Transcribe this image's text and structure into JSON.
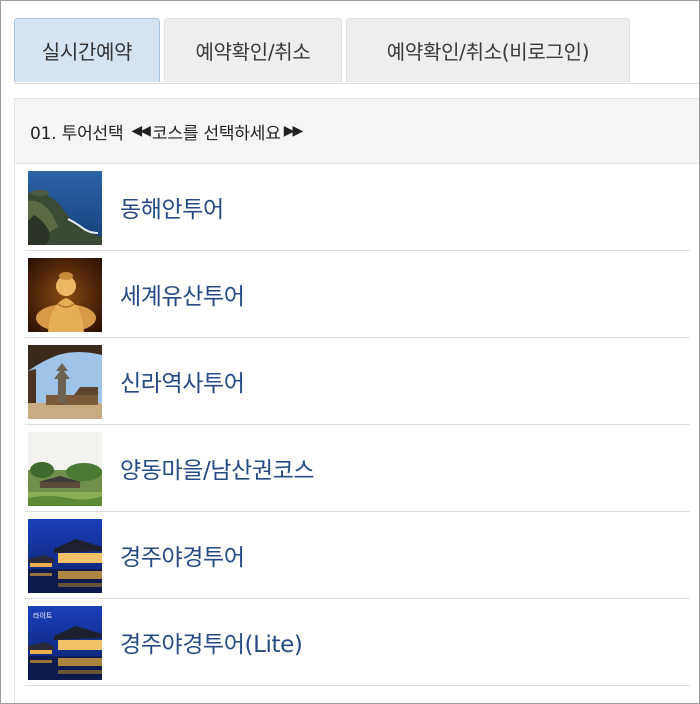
{
  "tabs": [
    {
      "label": "실시간예약",
      "active": true
    },
    {
      "label": "예약확인/취소",
      "active": false
    },
    {
      "label": "예약확인/취소(비로그인)",
      "active": false
    }
  ],
  "panel": {
    "step_label": "01. 투어선택",
    "arrows_left": "◀◀",
    "instruction": "코스를 선택하세요",
    "arrows_right": "▶▶"
  },
  "tours": [
    {
      "name": "동해안투어",
      "thumbnail_icon": "coast-photo"
    },
    {
      "name": "세계유산투어",
      "thumbnail_icon": "buddha-statue-photo"
    },
    {
      "name": "신라역사투어",
      "thumbnail_icon": "pagoda-photo"
    },
    {
      "name": "양동마을/남산권코스",
      "thumbnail_icon": "village-photo"
    },
    {
      "name": "경주야경투어",
      "thumbnail_icon": "night-palace-photo"
    },
    {
      "name": "경주야경투어(Lite)",
      "thumbnail_icon": "night-palace-lite-photo",
      "thumbnail_text": "라이트"
    }
  ],
  "colors": {
    "active_tab": "#d6e3f1",
    "tab": "#eeeeee",
    "tour_link": "#254a84",
    "header_bg": "#f5f5f5"
  }
}
